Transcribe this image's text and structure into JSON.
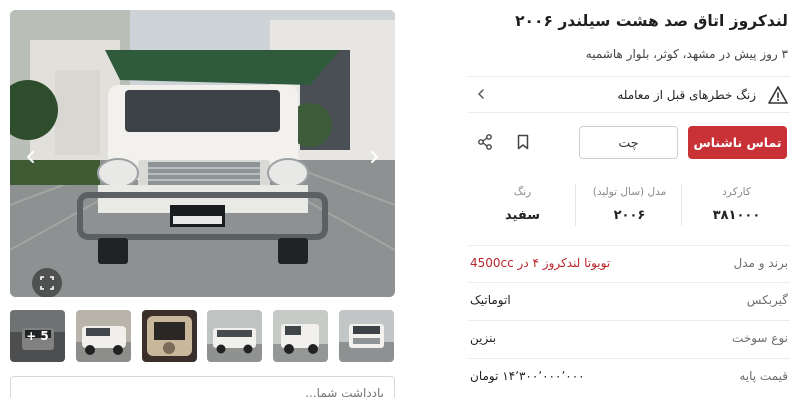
{
  "listing": {
    "title": "لندکروز اتاق صد هشت سیلندر ۲۰۰۶",
    "subtitle": "۳ روز پیش در مشهد، کوثر، بلوار هاشمیه"
  },
  "alert": {
    "text": "زنگ خطرهای قبل از معامله",
    "icon": "warning-triangle-icon"
  },
  "actions": {
    "contact_label": "تماس ناشناس",
    "chat_label": "چت",
    "bookmark_icon": "bookmark-icon",
    "share_icon": "share-icon",
    "accent_color": "#c83236"
  },
  "stats": [
    {
      "label": "کارکرد",
      "value": "۳۸۱۰۰۰"
    },
    {
      "label": "مدل (سال تولید)",
      "value": "۲۰۰۶"
    },
    {
      "label": "رنگ",
      "value": "سفید"
    }
  ],
  "specs": [
    {
      "key": "برند و مدل",
      "value": "تویوتا لندکروز ۴ در 4500cc"
    },
    {
      "key": "گیربکس",
      "value": "اتوماتیک"
    },
    {
      "key": "نوع سوخت",
      "value": "بنزین"
    },
    {
      "key": "قیمت پایه",
      "value": "۱۴٬۳۰۰٬۰۰۰٬۰۰۰ تومان"
    }
  ],
  "gallery": {
    "more_count_label": "+ 5",
    "note_placeholder": "یادداشت شما..."
  }
}
